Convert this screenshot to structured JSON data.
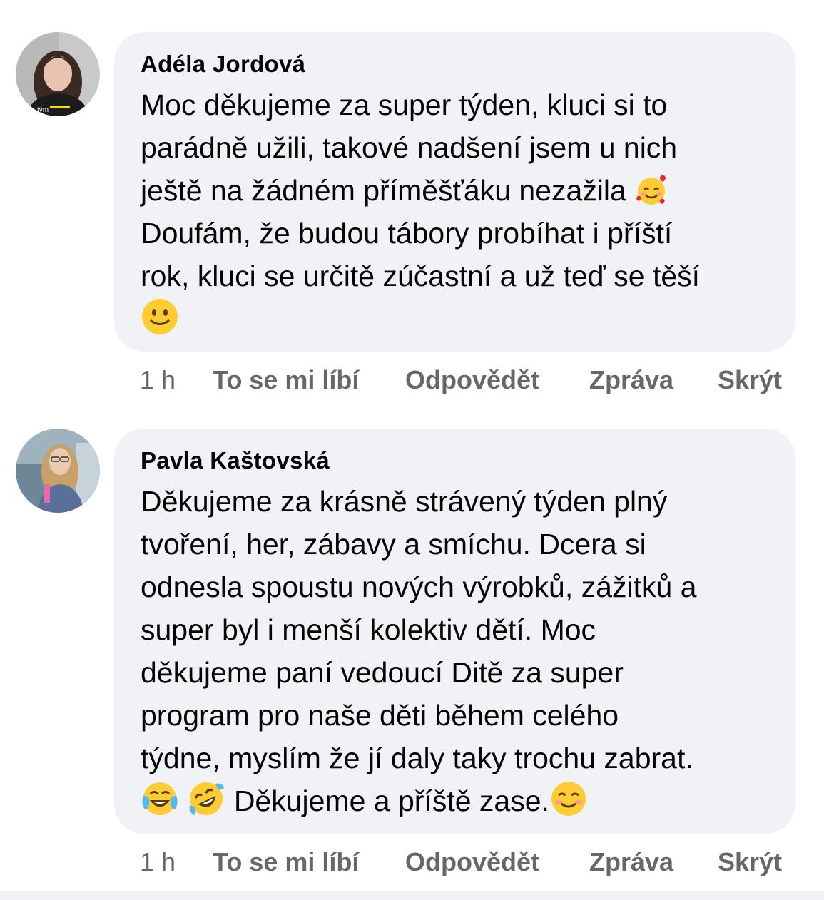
{
  "comments": [
    {
      "author": "Adéla Jordová",
      "lines": [
        "Moc děkujeme za super týden, kluci si to",
        "parádně užili, takové nadšení jsem u nich",
        "ještě na žádném příměšťáku nezažila",
        "Doufám, že budou tábory probíhat i příští",
        "rok, kluci se určitě zúčastní a už teď se těší"
      ],
      "avatar_text": "tým",
      "emojis": [
        "smiling-face-with-hearts-emoji",
        "slightly-smiling-face-emoji"
      ],
      "actions": {
        "time": "1 h",
        "like": "To se mi líbí",
        "reply": "Odpovědět",
        "message": "Zpráva",
        "hide": "Skrýt"
      }
    },
    {
      "author": "Pavla Kaštovská",
      "lines": [
        "Děkujeme za krásně strávený týden plný",
        "tvoření, her, zábavy a smíchu. Dcera si",
        "odnesla spoustu nových výrobků, zážitků a",
        "super byl i menší kolektiv dětí. Moc",
        "děkujeme paní vedoucí Ditě za super",
        "program pro naše děti během celého",
        "týdne, myslím že jí daly taky trochu zabrat.",
        "Děkujeme a příště zase."
      ],
      "emojis": [
        "face-with-tears-of-joy-emoji",
        "rolling-on-floor-laughing-emoji",
        "smiling-face-emoji"
      ],
      "actions": {
        "time": "1 h",
        "like": "To se mi líbí",
        "reply": "Odpovědět",
        "message": "Zpráva",
        "hide": "Skrýt"
      }
    }
  ],
  "colors": {
    "bubble_bg": "#f0f2f5",
    "text_primary": "#050505",
    "text_secondary": "#65676b",
    "emoji_yellow": "#ffcc33"
  }
}
